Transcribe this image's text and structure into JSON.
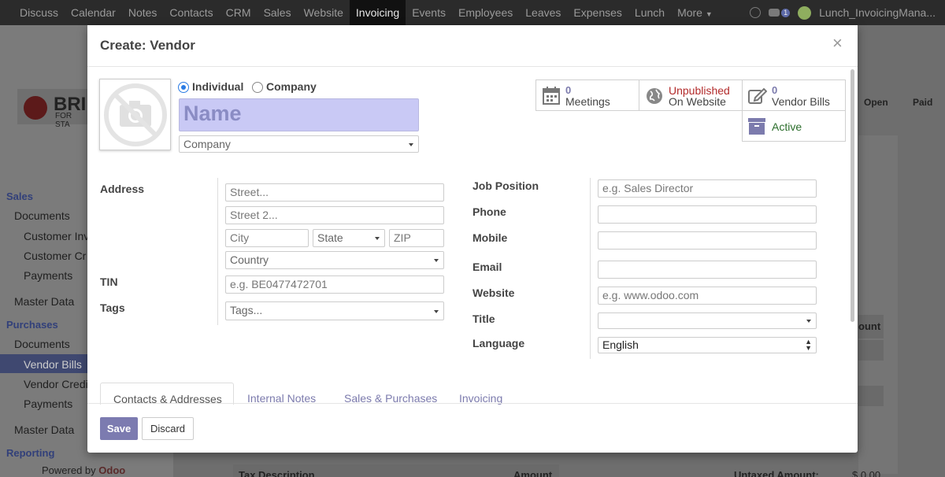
{
  "topbar": {
    "menu": [
      "Discuss",
      "Calendar",
      "Notes",
      "Contacts",
      "CRM",
      "Sales",
      "Website",
      "Invoicing",
      "Events",
      "Employees",
      "Leaves",
      "Expenses",
      "Lunch",
      "More"
    ],
    "active": "Invoicing",
    "chat_count": "1",
    "user": "Lunch_InvoicingMana..."
  },
  "background": {
    "logo_text": "BRI",
    "logo_sub": "FOR STA",
    "sidebar": {
      "sales_header": "Sales",
      "documents1": "Documents",
      "customer_inv": "Customer Inv",
      "customer_cr": "Customer Cr",
      "payments1": "Payments",
      "master_data1": "Master Data",
      "purchases_header": "Purchases",
      "documents2": "Documents",
      "vendor_bills": "Vendor Bills",
      "vendor_credit": "Vendor Credi",
      "payments2": "Payments",
      "master_data2": "Master Data",
      "reporting_header": "Reporting",
      "powered_by": "Powered by",
      "odoo": "Odoo"
    },
    "statusbar": [
      "Open",
      "Paid"
    ],
    "amount_col": "ount",
    "tax_description": "Tax Description",
    "amount": "Amount",
    "untaxed_amount": "Untaxed Amount:",
    "untaxed_value": "$ 0.00"
  },
  "modal": {
    "title": "Create: Vendor",
    "close": "×",
    "radio_individual": "Individual",
    "radio_company": "Company",
    "selected_type": "Individual",
    "name_placeholder": "Name",
    "company_placeholder": "Company",
    "smart_buttons": {
      "meetings_count": "0",
      "meetings_label": "Meetings",
      "website_status": "Unpublished",
      "website_label": "On Website",
      "vendor_bills_count": "0",
      "vendor_bills_label": "Vendor Bills",
      "active_label": "Active"
    },
    "left_fields": {
      "address_label": "Address",
      "street_placeholder": "Street...",
      "street2_placeholder": "Street 2...",
      "city_placeholder": "City",
      "state_placeholder": "State",
      "zip_placeholder": "ZIP",
      "country_placeholder": "Country",
      "tin_label": "TIN",
      "tin_placeholder": "e.g. BE0477472701",
      "tags_label": "Tags",
      "tags_placeholder": "Tags..."
    },
    "right_fields": {
      "job_position_label": "Job Position",
      "job_position_placeholder": "e.g. Sales Director",
      "phone_label": "Phone",
      "mobile_label": "Mobile",
      "email_label": "Email",
      "website_label": "Website",
      "website_placeholder": "e.g. www.odoo.com",
      "title_label": "Title",
      "language_label": "Language",
      "language_value": "English"
    },
    "tabs": [
      "Contacts & Addresses",
      "Internal Notes",
      "Sales & Purchases",
      "Invoicing"
    ],
    "active_tab": "Contacts & Addresses",
    "save_label": "Save",
    "discard_label": "Discard"
  }
}
